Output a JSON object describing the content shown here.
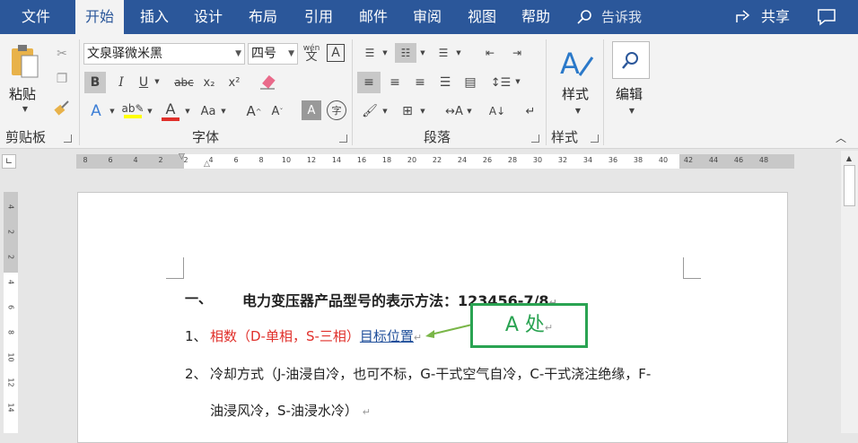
{
  "tabs": [
    "文件",
    "开始",
    "插入",
    "设计",
    "布局",
    "引用",
    "邮件",
    "审阅",
    "视图",
    "帮助"
  ],
  "tell_me": "告诉我",
  "share": "共享",
  "ribbon": {
    "clipboard": {
      "paste": "粘贴",
      "label": "剪贴板"
    },
    "font": {
      "name": "文泉驿微米黑",
      "size": "四号",
      "phonetic": "wén",
      "label": "字体"
    },
    "paragraph": {
      "label": "段落"
    },
    "styles": {
      "button": "样式",
      "label": "样式"
    },
    "editing": {
      "button": "编辑"
    }
  },
  "ruler": {
    "h_ticks": [
      "8",
      "6",
      "4",
      "2",
      "2",
      "4",
      "6",
      "8",
      "10",
      "12",
      "14",
      "16",
      "18",
      "20",
      "22",
      "24",
      "26",
      "28",
      "30",
      "32",
      "34",
      "36",
      "38",
      "40",
      "42",
      "44",
      "46",
      "48"
    ],
    "v_ticks": [
      "4",
      "2",
      "2",
      "4",
      "6",
      "8",
      "10",
      "12",
      "14"
    ]
  },
  "document": {
    "heading_num": "一、",
    "heading_text": "电力变压器产品型号的表示方法：123456-7/8",
    "item1_num": "1、",
    "item1_red": "相数（D-单相，S-三相）",
    "item1_link": "目标位置",
    "item2_num": "2、",
    "item2_line1": "冷却方式（J-油浸自冷，也可不标，G-干式空气自冷，C-干式浇注绝缘，F-",
    "item2_line2": "油浸风冷，S-油浸水冷）",
    "para_mark": "↵"
  },
  "callout": {
    "text": "A 处"
  },
  "colors": {
    "accent": "#2b579a",
    "callout": "#2aa352",
    "red_text": "#e0302b",
    "link": "#1f4e9a"
  }
}
